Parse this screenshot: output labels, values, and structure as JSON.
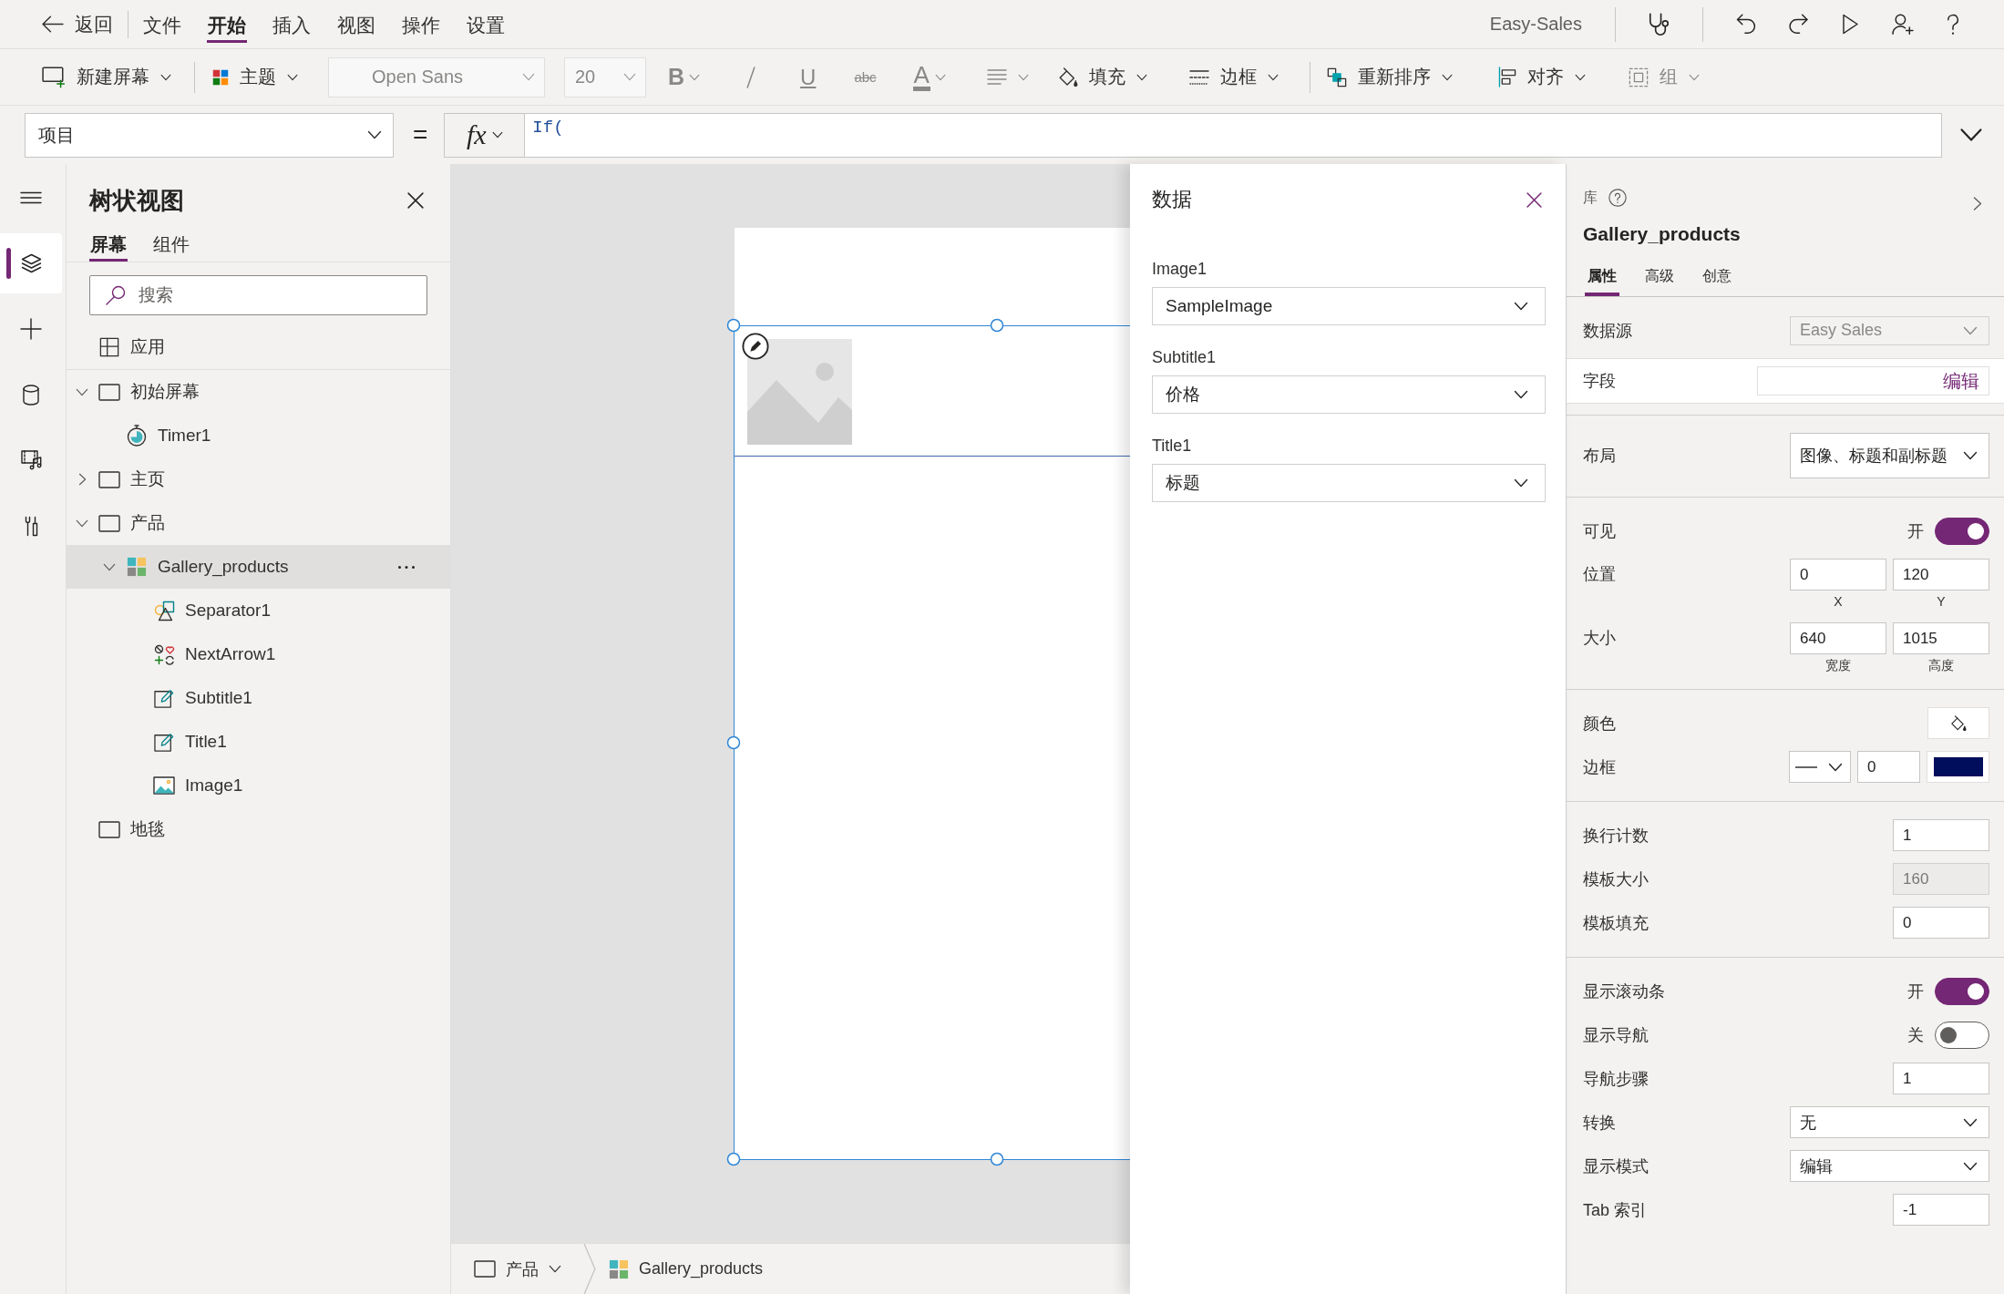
{
  "menu_bar": {
    "back": "返回",
    "menus": [
      {
        "label": "文件",
        "selected": false
      },
      {
        "label": "开始",
        "selected": true
      },
      {
        "label": "插入",
        "selected": false
      },
      {
        "label": "视图",
        "selected": false
      },
      {
        "label": "操作",
        "selected": false
      },
      {
        "label": "设置",
        "selected": false
      }
    ],
    "app_name": "Easy-Sales"
  },
  "toolbar": [
    {
      "kind": "screen",
      "label": "新建屏幕",
      "disabled": false
    },
    {
      "kind": "theme",
      "label": "主题",
      "disabled": false
    },
    {
      "kind": "font",
      "value": "Open Sans",
      "disabled": true
    },
    {
      "kind": "size",
      "value": "20",
      "disabled": true
    },
    {
      "kind": "bold",
      "glyph": "B",
      "disabled": true
    },
    {
      "kind": "italic",
      "disabled": true
    },
    {
      "kind": "underline",
      "glyph": "U",
      "disabled": true
    },
    {
      "kind": "strike",
      "glyph": "abc",
      "disabled": true
    },
    {
      "kind": "color",
      "glyph": "A",
      "disabled": true
    },
    {
      "kind": "paragraph",
      "disabled": true
    },
    {
      "kind": "fill",
      "label": "填充",
      "disabled": false
    },
    {
      "kind": "border",
      "label": "边框",
      "disabled": false
    },
    {
      "kind": "reorder",
      "label": "重新排序",
      "disabled": false
    },
    {
      "kind": "align",
      "label": "对齐",
      "disabled": false
    },
    {
      "kind": "group",
      "label": "组",
      "disabled": true
    }
  ],
  "formula_bar": {
    "property": "项目",
    "equals": "=",
    "fx": "fx",
    "formula": "If("
  },
  "rail": [
    {
      "kind": "layers",
      "selected": true
    },
    {
      "kind": "insert",
      "selected": false
    },
    {
      "kind": "data",
      "selected": false
    },
    {
      "kind": "media",
      "selected": false
    },
    {
      "kind": "tools",
      "selected": false
    }
  ],
  "tree_panel": {
    "title": "树状视图",
    "tabs": [
      {
        "label": "屏幕",
        "selected": true
      },
      {
        "label": "组件",
        "selected": false
      }
    ],
    "search": {
      "placeholder": "搜索"
    },
    "items": [
      {
        "label": "应用",
        "kind": "app",
        "selected": false
      },
      {
        "label": "初始屏幕",
        "kind": "screen",
        "expanded": true,
        "selected": false,
        "children": [
          {
            "label": "Timer1",
            "kind": "timer",
            "selected": false
          }
        ]
      },
      {
        "label": "主页",
        "kind": "screen",
        "expanded": false,
        "selected": false
      },
      {
        "label": "产品",
        "kind": "screen",
        "expanded": true,
        "selected": false,
        "children": [
          {
            "label": "Gallery_products",
            "kind": "gallery",
            "expanded": true,
            "selected": true,
            "children": [
              {
                "label": "Separator1",
                "kind": "shape",
                "selected": false
              },
              {
                "label": "NextArrow1",
                "kind": "icons",
                "selected": false
              },
              {
                "label": "Subtitle1",
                "kind": "label",
                "selected": false
              },
              {
                "label": "Title1",
                "kind": "label",
                "selected": false
              },
              {
                "label": "Image1",
                "kind": "image",
                "selected": false
              }
            ]
          }
        ]
      },
      {
        "label": "地毯",
        "kind": "screen",
        "selected": false
      }
    ]
  },
  "canvas": {
    "breadcrumb": [
      {
        "kind": "screen",
        "label": "产品"
      },
      {
        "kind": "gallery",
        "label": "Gallery_products"
      }
    ]
  },
  "data_panel": {
    "title": "数据",
    "fields": [
      {
        "label": "Image1",
        "value": "SampleImage"
      },
      {
        "label": "Subtitle1",
        "value": "价格"
      },
      {
        "label": "Title1",
        "value": "标题"
      }
    ]
  },
  "properties_panel": {
    "category": "库",
    "title": "Gallery_products",
    "tabs": [
      {
        "label": "属性",
        "selected": true
      },
      {
        "label": "高级",
        "selected": false
      },
      {
        "label": "创意",
        "selected": false
      }
    ],
    "sections": [
      {
        "rows": [
          {
            "kind": "select",
            "label": "数据源",
            "value": "Easy Sales",
            "disabled": true
          },
          {
            "kind": "link",
            "label": "字段",
            "value": "编辑"
          }
        ]
      },
      {
        "rows": [
          {
            "kind": "select",
            "label": "布局",
            "value": "图像、标题和副标题",
            "disabled": false
          }
        ]
      },
      {
        "rows": [
          {
            "kind": "toggle",
            "label": "可见",
            "state": "开",
            "on": true
          },
          {
            "kind": "pair",
            "label": "位置",
            "inputs": [
              {
                "value": "0",
                "caption": "X"
              },
              {
                "value": "120",
                "caption": "Y"
              }
            ]
          },
          {
            "kind": "pair",
            "label": "大小",
            "inputs": [
              {
                "value": "640",
                "caption": "宽度"
              },
              {
                "value": "1015",
                "caption": "高度"
              }
            ]
          }
        ]
      },
      {
        "rows": [
          {
            "kind": "color",
            "label": "颜色"
          },
          {
            "kind": "border",
            "label": "边框",
            "value": "0",
            "color": "#000e5c"
          }
        ]
      },
      {
        "rows": [
          {
            "kind": "number",
            "label": "换行计数",
            "value": "1",
            "disabled": false
          },
          {
            "kind": "number",
            "label": "模板大小",
            "value": "160",
            "disabled": true
          },
          {
            "kind": "number",
            "label": "模板填充",
            "value": "0",
            "disabled": false
          }
        ]
      },
      {
        "rows": [
          {
            "kind": "toggle",
            "label": "显示滚动条",
            "state": "开",
            "on": true
          },
          {
            "kind": "toggle",
            "label": "显示导航",
            "state": "关",
            "on": false
          },
          {
            "kind": "number",
            "label": "导航步骤",
            "value": "1",
            "disabled": false
          },
          {
            "kind": "select",
            "label": "转换",
            "value": "无",
            "disabled": false
          },
          {
            "kind": "select",
            "label": "显示模式",
            "value": "编辑",
            "disabled": false
          },
          {
            "kind": "number",
            "label": "Tab 索引",
            "value": "-1",
            "disabled": false
          }
        ]
      }
    ]
  }
}
